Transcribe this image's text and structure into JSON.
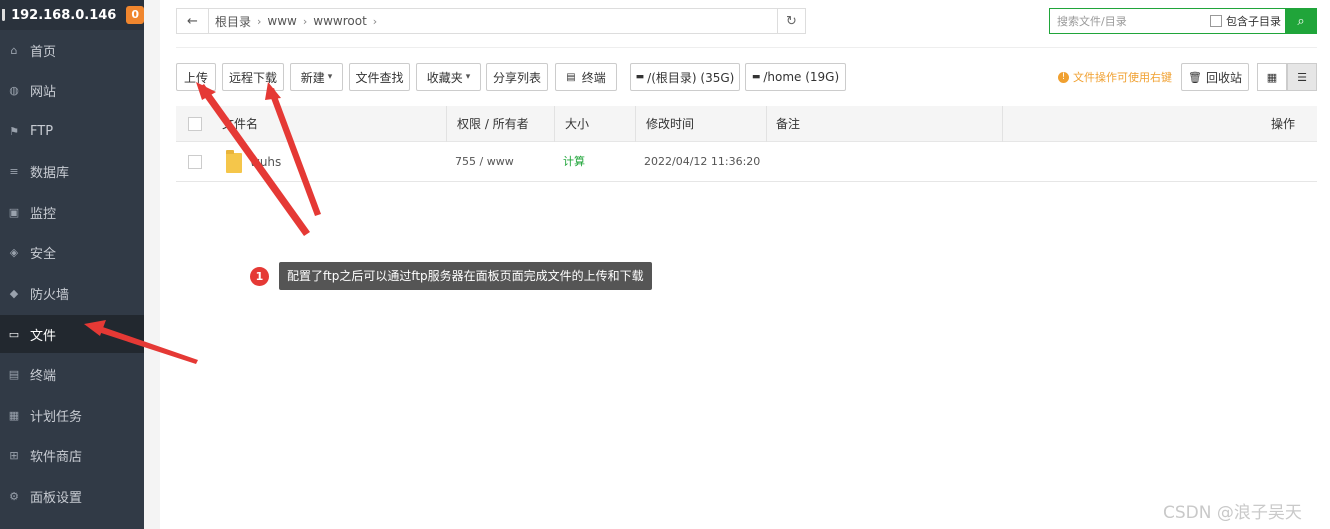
{
  "sidebar": {
    "host": "192.168.0.146",
    "badge": "0",
    "items": [
      {
        "label": "首页",
        "icon": "home-icon"
      },
      {
        "label": "网站",
        "icon": "globe-icon"
      },
      {
        "label": "FTP",
        "icon": "ftp-icon"
      },
      {
        "label": "数据库",
        "icon": "database-icon"
      },
      {
        "label": "监控",
        "icon": "monitor-icon"
      },
      {
        "label": "安全",
        "icon": "shield-icon"
      },
      {
        "label": "防火墙",
        "icon": "firewall-icon"
      },
      {
        "label": "文件",
        "icon": "folder-icon",
        "active": true
      },
      {
        "label": "终端",
        "icon": "terminal-icon"
      },
      {
        "label": "计划任务",
        "icon": "calendar-icon"
      },
      {
        "label": "软件商店",
        "icon": "apps-icon"
      },
      {
        "label": "面板设置",
        "icon": "gear-icon"
      }
    ]
  },
  "path": {
    "crumbs": [
      "根目录",
      "www",
      "wwwroot"
    ]
  },
  "search": {
    "placeholder": "搜索文件/目录",
    "include_sub": "包含子目录"
  },
  "toolbar": {
    "upload": "上传",
    "remote_download": "远程下载",
    "new": "新建",
    "file_search": "文件查找",
    "favorites": "收藏夹",
    "share_list": "分享列表",
    "terminal": "终端",
    "disk_root": "/(根目录) (35G)",
    "disk_home": "/home (19G)",
    "tip": "文件操作可使用右键",
    "recycle": "回收站"
  },
  "table": {
    "headers": [
      "文件名",
      "权限 / 所有者",
      "大小",
      "修改时间",
      "备注",
      "操作"
    ],
    "rows": [
      {
        "name": "wuhs",
        "perm": "755 / www",
        "size": "计算",
        "mtime": "2022/04/12 11:36:20"
      }
    ]
  },
  "annotation": {
    "number": "1",
    "text": "配置了ftp之后可以通过ftp服务器在面板页面完成文件的上传和下载"
  },
  "watermark": "CSDN @浪子吴天",
  "colors": {
    "sidebar_bg": "#313a46",
    "accent_green": "#20a53a",
    "annotation_red": "#e53935"
  }
}
